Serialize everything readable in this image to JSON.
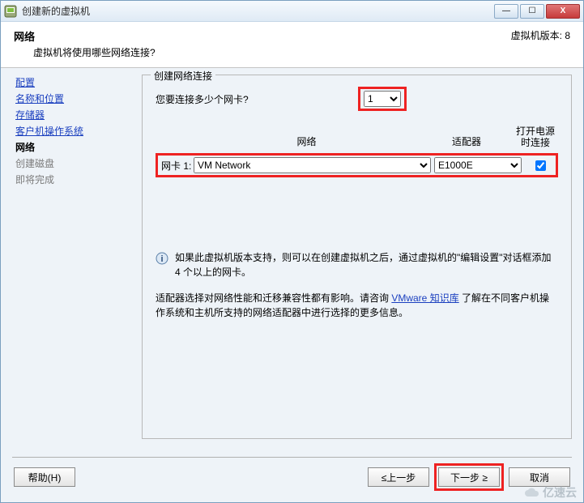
{
  "title": "创建新的虚拟机",
  "window_controls": {
    "min": "—",
    "max": "☐",
    "close": "X"
  },
  "header": {
    "title": "网络",
    "subtitle": "虚拟机将使用哪些网络连接?",
    "version": "虚拟机版本: 8"
  },
  "sidebar": {
    "items": [
      {
        "label": "配置",
        "state": "done"
      },
      {
        "label": "名称和位置",
        "state": "done"
      },
      {
        "label": "存储器",
        "state": "done"
      },
      {
        "label": "客户机操作系统",
        "state": "done"
      },
      {
        "label": "网络",
        "state": "current"
      },
      {
        "label": "创建磁盘",
        "state": "future"
      },
      {
        "label": "即将完成",
        "state": "future"
      }
    ]
  },
  "group": {
    "legend": "创建网络连接",
    "question": "您要连接多少个网卡?",
    "nic_count": "1",
    "columns": {
      "network": "网络",
      "adapter": "适配器",
      "power": "打开电源时连接"
    },
    "nic_label": "网卡 1:",
    "network_value": "VM Network",
    "adapter_value": "E1000E",
    "connect_checked": true,
    "info1": "如果此虚拟机版本支持，则可以在创建虚拟机之后，通过虚拟机的\"编辑设置\"对话框添加 4 个以上的网卡。",
    "info2_a": "适配器选择对网络性能和迁移兼容性都有影响。请咨询 ",
    "info2_link": "VMware 知识库",
    "info2_b": " 了解在不同客户机操作系统和主机所支持的网络适配器中进行选择的更多信息。"
  },
  "footer": {
    "help": "帮助(H)",
    "back": "≤上一步",
    "next": "下一步 ≥",
    "cancel": "取消"
  },
  "watermark": "亿速云"
}
